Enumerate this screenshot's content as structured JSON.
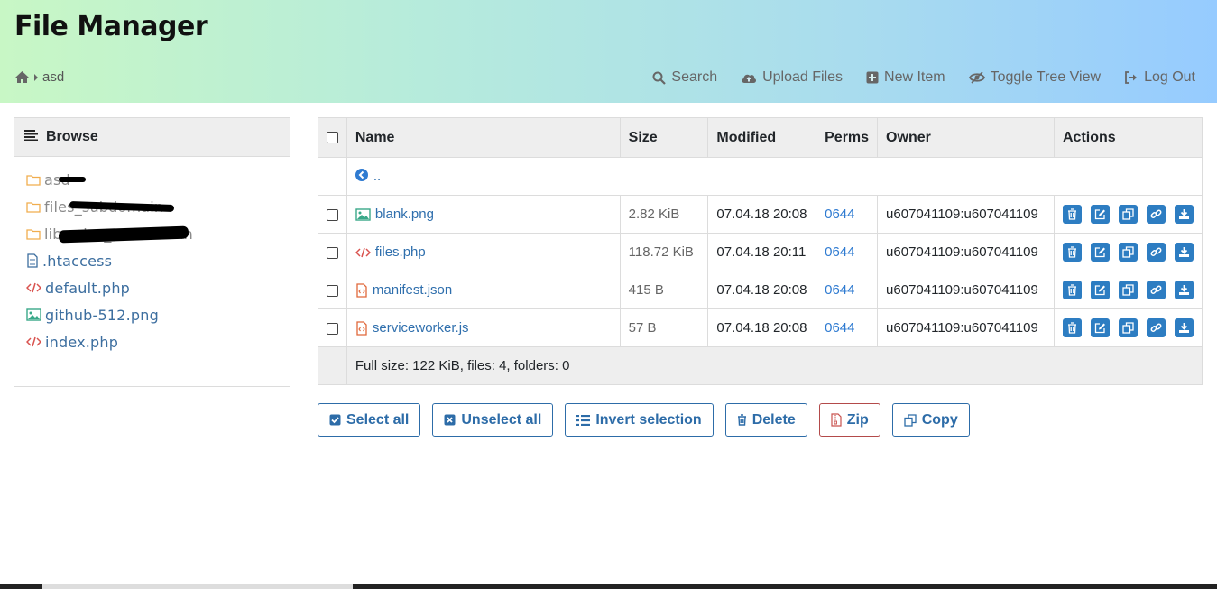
{
  "app": {
    "title": "File Manager"
  },
  "breadcrumb": {
    "current": "asd"
  },
  "nav": [
    {
      "label": "Search",
      "icon": "search-icon"
    },
    {
      "label": "Upload Files",
      "icon": "cloud-upload-icon"
    },
    {
      "label": "New Item",
      "icon": "plus-square-icon"
    },
    {
      "label": "Toggle Tree View",
      "icon": "eye-slash-icon"
    },
    {
      "label": "Log Out",
      "icon": "sign-out-icon"
    }
  ],
  "browse": {
    "heading": "Browse",
    "items": [
      {
        "label": "asd",
        "type": "folder",
        "icon": "folder-icon"
      },
      {
        "label": "files_subdomain",
        "type": "folder",
        "icon": "folder-icon"
      },
      {
        "label": "libraries_subdomain",
        "type": "folder",
        "icon": "folder-icon"
      },
      {
        "label": ".htaccess",
        "type": "file",
        "icon": "file-text-icon"
      },
      {
        "label": "default.php",
        "type": "code",
        "icon": "code-icon"
      },
      {
        "label": "github-512.png",
        "type": "image",
        "icon": "image-icon"
      },
      {
        "label": "index.php",
        "type": "code",
        "icon": "code-icon"
      }
    ]
  },
  "table": {
    "headers": {
      "name": "Name",
      "size": "Size",
      "modified": "Modified",
      "perms": "Perms",
      "owner": "Owner",
      "actions": "Actions"
    },
    "up_label": "..",
    "rows": [
      {
        "name": "blank.png",
        "icon": "image-icon",
        "size": "2.82 KiB",
        "modified": "07.04.18 20:08",
        "perms": "0644",
        "owner": "u607041109:u607041109"
      },
      {
        "name": "files.php",
        "icon": "code-icon",
        "size": "118.72 KiB",
        "modified": "07.04.18 20:11",
        "perms": "0644",
        "owner": "u607041109:u607041109"
      },
      {
        "name": "manifest.json",
        "icon": "code-file-icon",
        "size": "415 B",
        "modified": "07.04.18 20:08",
        "perms": "0644",
        "owner": "u607041109:u607041109"
      },
      {
        "name": "serviceworker.js",
        "icon": "code-file-icon",
        "size": "57 B",
        "modified": "07.04.18 20:08",
        "perms": "0644",
        "owner": "u607041109:u607041109"
      }
    ],
    "footer": "Full size: 122 KiB, files: 4, folders: 0"
  },
  "buttons": {
    "select_all": "Select all",
    "unselect_all": "Unselect all",
    "invert": "Invert selection",
    "delete": "Delete",
    "zip": "Zip",
    "copy": "Copy"
  },
  "colors": {
    "accent": "#2d7dc2",
    "header_start": "#c8f7c5",
    "header_end": "#96cbff",
    "folder": "#f0ad4e",
    "code": "#d9534f",
    "image": "#3aa889"
  }
}
